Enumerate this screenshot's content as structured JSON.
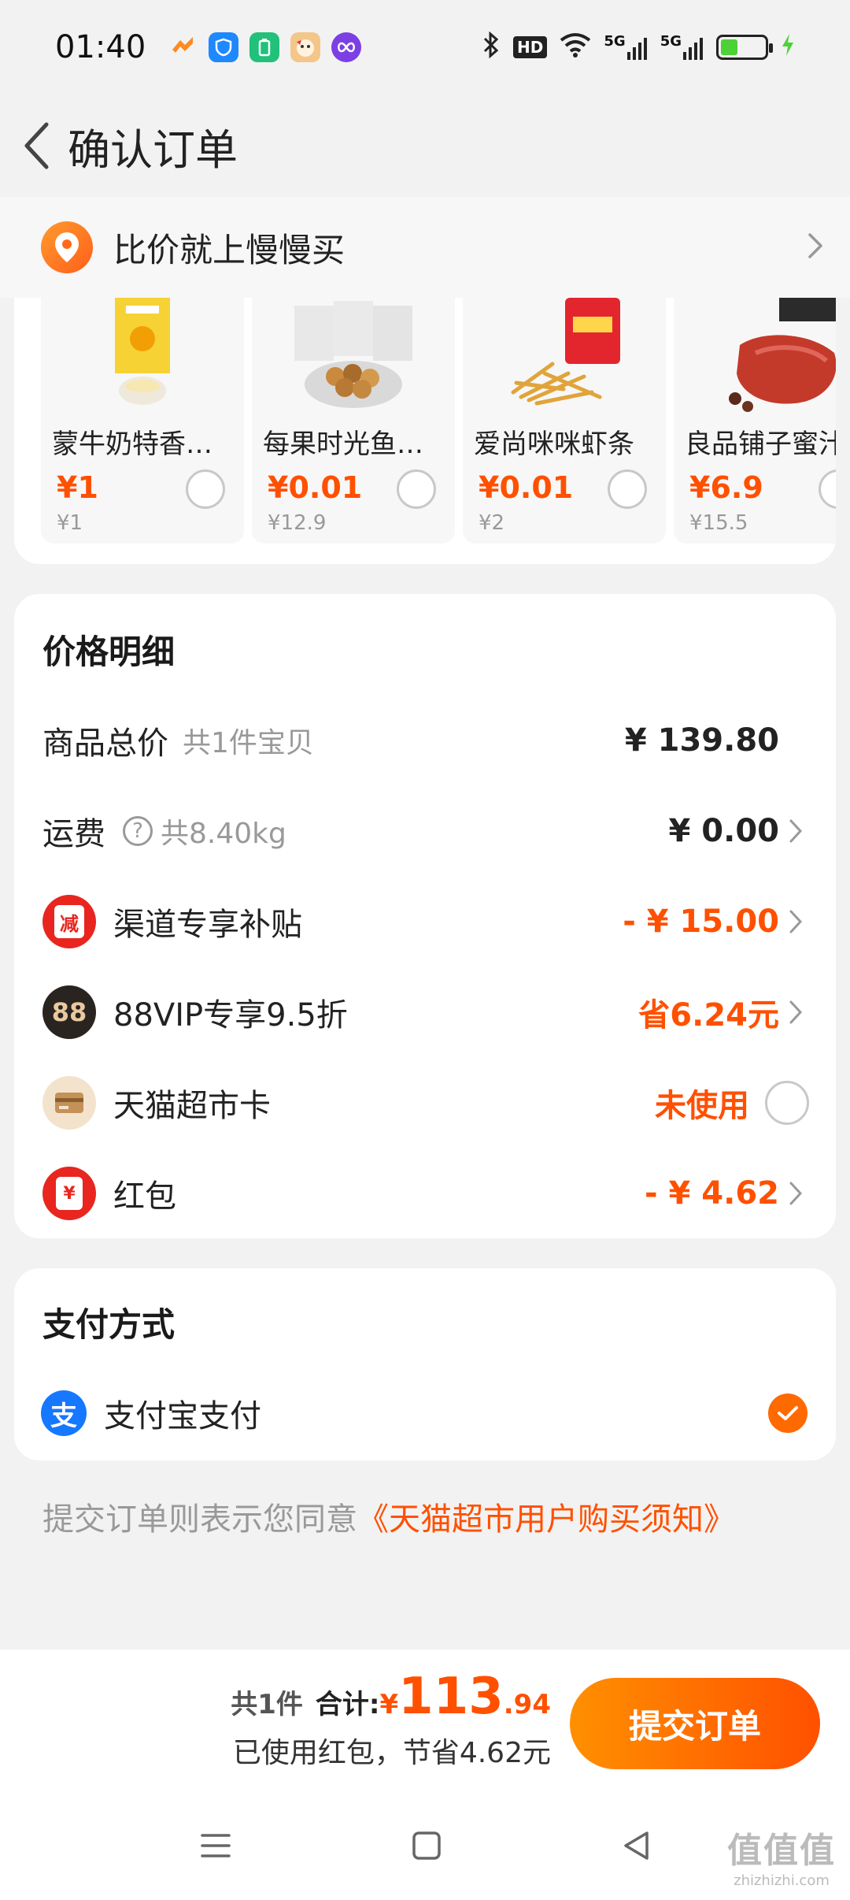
{
  "status_bar": {
    "time": "01:40",
    "network_labels": [
      "5G",
      "5G"
    ],
    "hd_label": "HD"
  },
  "nav": {
    "title": "确认订单"
  },
  "compare_banner": {
    "label": "比价就上慢慢买"
  },
  "products": [
    {
      "name": "蒙牛奶特香蕉牛奶",
      "price": "¥1",
      "original": "¥1"
    },
    {
      "name": "每果时光鱼皮花生",
      "price": "¥0.01",
      "original": "¥12.9"
    },
    {
      "name": "爱尚咪咪虾条",
      "price": "¥0.01",
      "original": "¥2"
    },
    {
      "name": "良品铺子蜜汁",
      "price": "¥6.9",
      "original": "¥15.5"
    }
  ],
  "price_detail": {
    "title": "价格明细",
    "goods_total_label": "商品总价",
    "goods_count": "共1件宝贝",
    "goods_total": "¥ 139.80",
    "shipping_label": "运费",
    "shipping_weight": "共8.40kg",
    "shipping_fee": "¥ 0.00",
    "channel_subsidy_label": "渠道专享补贴",
    "channel_subsidy_value": "- ¥ 15.00",
    "vip_label": "88VIP专享9.5折",
    "vip_value": "省6.24元",
    "vip_icon_text": "88",
    "market_card_label": "天猫超市卡",
    "market_card_value": "未使用",
    "redpacket_label": "红包",
    "redpacket_value": "- ¥ 4.62",
    "subsidy_icon_text": "减",
    "redpacket_icon_text": "¥"
  },
  "payment": {
    "title": "支付方式",
    "method_label": "支付宝支付",
    "alipay_icon_text": "支"
  },
  "agreement": {
    "prefix": "提交订单则表示您同意",
    "link": "《天猫超市用户购买须知》"
  },
  "bottom_bar": {
    "count": "共1件",
    "total_label": "合计:",
    "currency": "¥",
    "total_int": "113",
    "total_dec": ".94",
    "saved_text": "已使用红包，节省4.62元",
    "submit_label": "提交订单"
  },
  "watermark": {
    "main": "值值值",
    "sub": "zhizhizhi.com"
  },
  "colors": {
    "accent": "#ff5000",
    "alipay": "#1677ff"
  }
}
